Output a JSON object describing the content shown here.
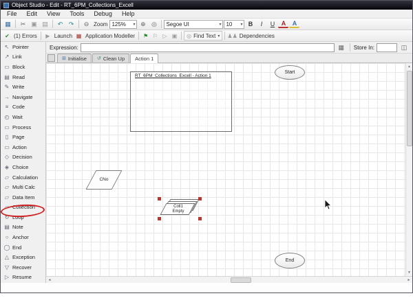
{
  "window": {
    "title": "Object Studio - Edit - RT_6PM_Collections_Excell"
  },
  "menubar": {
    "items": [
      {
        "label": "File"
      },
      {
        "label": "Edit"
      },
      {
        "label": "View"
      },
      {
        "label": "Tools"
      },
      {
        "label": "Debug"
      },
      {
        "label": "Help"
      }
    ]
  },
  "toolbar": {
    "save_icon": "▦",
    "cut_icon": "✂",
    "copy_icon": "▣",
    "paste_icon": "▤",
    "undo_icon": "↶",
    "redo_icon": "↷",
    "zoom_out_icon": "⊖",
    "zoom_label": "Zoom",
    "zoom_value": "125%",
    "zoom_in_icon": "⊕",
    "zoom_reset_icon": "◎",
    "font_value": "Segoe UI",
    "size_value": "10",
    "bold_label": "B",
    "italic_label": "I",
    "underline_label": "U",
    "font_color_label": "A",
    "fill_color_label": "A",
    "caret": "▾"
  },
  "actionbar": {
    "errors_icon": "✔",
    "errors_label": "(1) Errors",
    "launch_icon": "▶",
    "launch_label": "Launch",
    "modeller_icon": "▦",
    "modeller_label": "Application Modeller",
    "flag_green_icon": "⚑",
    "flag_white_icon": "⚐",
    "step_icon_1": "▷",
    "step_icon_2": "▣",
    "find_icon": "◎",
    "find_label": "Find Text",
    "dependencies_icon": "♟♟",
    "dependencies_label": "Dependencies",
    "caret": "▾"
  },
  "expression_bar": {
    "label": "Expression:",
    "value": "",
    "helper_icon": "▦",
    "store_label": "Store In:",
    "store_value": "",
    "store_icon": "◫"
  },
  "tabs": {
    "initialise": {
      "icon": "⊞",
      "label": "Initialise"
    },
    "cleanup": {
      "icon": "↺",
      "label": "Clean Up"
    },
    "action1": {
      "label": "Action 1"
    }
  },
  "sidebar": {
    "items": [
      {
        "glyph": "↖",
        "label": "Pointer"
      },
      {
        "glyph": "↗",
        "label": "Link"
      },
      {
        "glyph": "▭",
        "label": "Block"
      },
      {
        "glyph": "▤",
        "label": "Read"
      },
      {
        "glyph": "✎",
        "label": "Write"
      },
      {
        "glyph": "→",
        "label": "Navigate"
      },
      {
        "glyph": "≡",
        "label": "Code"
      },
      {
        "glyph": "◴",
        "label": "Wait"
      },
      {
        "glyph": "▭",
        "label": "Process"
      },
      {
        "glyph": "▯",
        "label": "Page"
      },
      {
        "glyph": "▭",
        "label": "Action"
      },
      {
        "glyph": "◇",
        "label": "Decision"
      },
      {
        "glyph": "◈",
        "label": "Choice"
      },
      {
        "glyph": "▱",
        "label": "Calculation"
      },
      {
        "glyph": "▱",
        "label": "Multi Calc"
      },
      {
        "glyph": "▱",
        "label": "Data Item"
      },
      {
        "glyph": "▱",
        "label": "Collection"
      },
      {
        "glyph": "↻",
        "label": "Loop"
      },
      {
        "glyph": "▤",
        "label": "Note"
      },
      {
        "glyph": "○",
        "label": "Anchor"
      },
      {
        "glyph": "◯",
        "label": "End"
      },
      {
        "glyph": "△",
        "label": "Exception"
      },
      {
        "glyph": "▽",
        "label": "Recover"
      },
      {
        "glyph": "▷",
        "label": "Resume"
      }
    ]
  },
  "canvas": {
    "frame_title": "RT_6PM_Collections_Excell - Action 1",
    "start_label": "Start",
    "end_label": "End",
    "data_item_label": "CNo",
    "collection_name": "Coll1",
    "collection_state": "Empty"
  },
  "scrollbars": {
    "up": "▲",
    "down": "▼",
    "left": "◄",
    "right": "►"
  }
}
